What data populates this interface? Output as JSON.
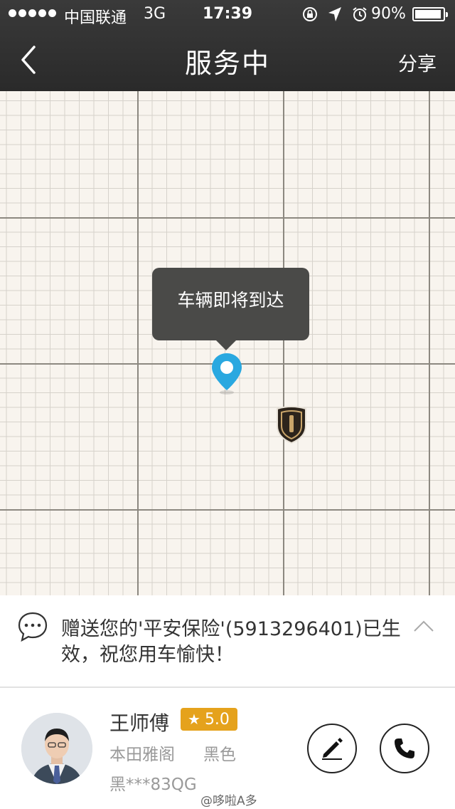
{
  "status_bar": {
    "carrier": "中国联通",
    "network": "3G",
    "time": "17:39",
    "battery_percent": "90%"
  },
  "nav": {
    "title": "服务中",
    "share_label": "分享"
  },
  "map": {
    "callout_text": "车辆即将到达",
    "pin_color": "#29a8e0",
    "car_marker_color": "#2c241c"
  },
  "notice": {
    "text": "赠送您的'平安保险'(5913296401)已生效，祝您用车愉快！"
  },
  "driver": {
    "name": "王师傅",
    "rating": "5.0",
    "car_model": "本田雅阁",
    "car_color": "黑色",
    "plate": "黑***83QG"
  },
  "watermark": "@哆啦A多",
  "colors": {
    "rating_badge": "#e5a21c",
    "topbar": "#2e2e2e"
  }
}
